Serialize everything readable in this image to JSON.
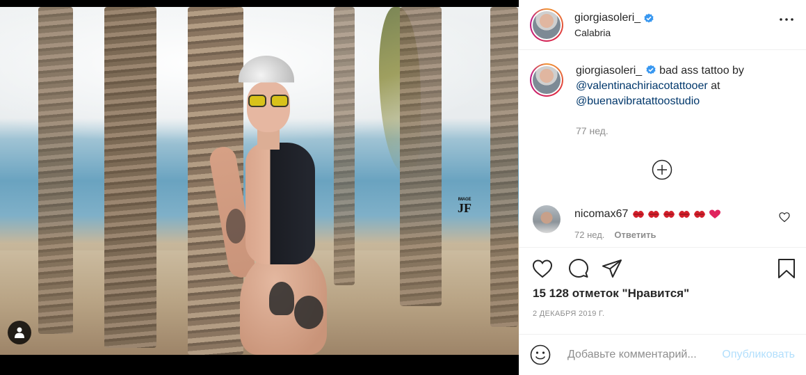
{
  "media": {
    "watermark_top": "IMAGE",
    "watermark_main": "JF"
  },
  "header": {
    "username": "giorgiasoleri_",
    "location": "Calabria"
  },
  "caption": {
    "username": "giorgiasoleri_",
    "text_before": " bad ass tattoo by ",
    "mention_1": "@valentinachiriacotattooer",
    "text_middle": " at ",
    "mention_2": "@buenavibratattoostudio",
    "time": "77 нед."
  },
  "comment": {
    "username": "nicomax67",
    "time": "72 нед.",
    "reply_label": "Ответить"
  },
  "actions": {
    "likes": "15 128 отметок \"Нравится\"",
    "date": "2 ДЕКАБРЯ 2019 Г."
  },
  "comment_box": {
    "placeholder": "Добавьте комментарий...",
    "publish_label": "Опубликовать"
  },
  "colors": {
    "verified": "#3897f0",
    "mention": "#00376b",
    "publish_disabled": "#b2dffc",
    "kiss": "#d4202c"
  }
}
